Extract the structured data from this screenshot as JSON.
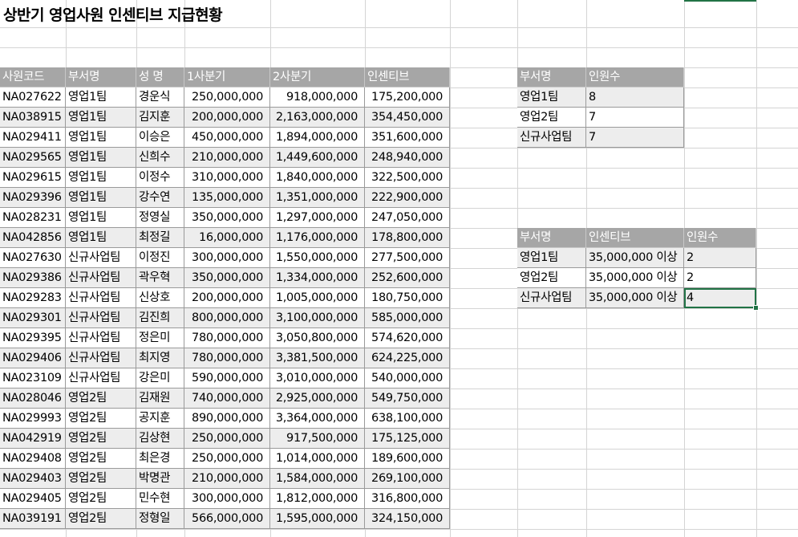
{
  "sheet": {
    "title": "상반기 영업사원 인센티브 지급현황",
    "accent_color": "#217346",
    "header_color": "#a6a6a6"
  },
  "main_table": {
    "headers": [
      "사원코드",
      "부서명",
      "성  명",
      "1사분기",
      "2사분기",
      "인센티브"
    ],
    "rows": [
      [
        "NA027622",
        "영업1팀",
        "경운식",
        "250,000,000",
        "918,000,000",
        "175,200,000"
      ],
      [
        "NA038915",
        "영업1팀",
        "김지훈",
        "200,000,000",
        "2,163,000,000",
        "354,450,000"
      ],
      [
        "NA029411",
        "영업1팀",
        "이승은",
        "450,000,000",
        "1,894,000,000",
        "351,600,000"
      ],
      [
        "NA029565",
        "영업1팀",
        "신희수",
        "210,000,000",
        "1,449,600,000",
        "248,940,000"
      ],
      [
        "NA029615",
        "영업1팀",
        "이정수",
        "310,000,000",
        "1,840,000,000",
        "322,500,000"
      ],
      [
        "NA029396",
        "영업1팀",
        "강수연",
        "135,000,000",
        "1,351,000,000",
        "222,900,000"
      ],
      [
        "NA028231",
        "영업1팀",
        "정영실",
        "350,000,000",
        "1,297,000,000",
        "247,050,000"
      ],
      [
        "NA042856",
        "영업1팀",
        "최정길",
        "16,000,000",
        "1,176,000,000",
        "178,800,000"
      ],
      [
        "NA027630",
        "신규사업팀",
        "이정진",
        "300,000,000",
        "1,550,000,000",
        "277,500,000"
      ],
      [
        "NA029386",
        "신규사업팀",
        "곽우혁",
        "350,000,000",
        "1,334,000,000",
        "252,600,000"
      ],
      [
        "NA029283",
        "신규사업팀",
        "신상호",
        "200,000,000",
        "1,005,000,000",
        "180,750,000"
      ],
      [
        "NA029301",
        "신규사업팀",
        "김진희",
        "800,000,000",
        "3,100,000,000",
        "585,000,000"
      ],
      [
        "NA029395",
        "신규사업팀",
        "정은미",
        "780,000,000",
        "3,050,800,000",
        "574,620,000"
      ],
      [
        "NA029406",
        "신규사업팀",
        "최지영",
        "780,000,000",
        "3,381,500,000",
        "624,225,000"
      ],
      [
        "NA023109",
        "신규사업팀",
        "강은미",
        "590,000,000",
        "3,010,000,000",
        "540,000,000"
      ],
      [
        "NA028046",
        "영업2팀",
        "김재원",
        "740,000,000",
        "2,925,000,000",
        "549,750,000"
      ],
      [
        "NA029993",
        "영업2팀",
        "공지훈",
        "890,000,000",
        "3,364,000,000",
        "638,100,000"
      ],
      [
        "NA042919",
        "영업2팀",
        "김상현",
        "250,000,000",
        "917,500,000",
        "175,125,000"
      ],
      [
        "NA029408",
        "영업2팀",
        "최은경",
        "250,000,000",
        "1,014,000,000",
        "189,600,000"
      ],
      [
        "NA029403",
        "영업2팀",
        "박명관",
        "210,000,000",
        "1,584,000,000",
        "269,100,000"
      ],
      [
        "NA029405",
        "영업2팀",
        "민수현",
        "300,000,000",
        "1,812,000,000",
        "316,800,000"
      ],
      [
        "NA039191",
        "영업2팀",
        "정형일",
        "566,000,000",
        "1,595,000,000",
        "324,150,000"
      ]
    ]
  },
  "summary_table_1": {
    "headers": [
      "부서명",
      "인원수"
    ],
    "rows": [
      [
        "영업1팀",
        "8"
      ],
      [
        "영업2팀",
        "7"
      ],
      [
        "신규사업팀",
        "7"
      ]
    ]
  },
  "summary_table_2": {
    "headers": [
      "부서명",
      "인센티브",
      "인원수"
    ],
    "rows": [
      [
        "영업1팀",
        "35,000,000 이상",
        "2"
      ],
      [
        "영업2팀",
        "35,000,000 이상",
        "2"
      ],
      [
        "신규사업팀",
        "35,000,000 이상",
        "4"
      ]
    ]
  }
}
